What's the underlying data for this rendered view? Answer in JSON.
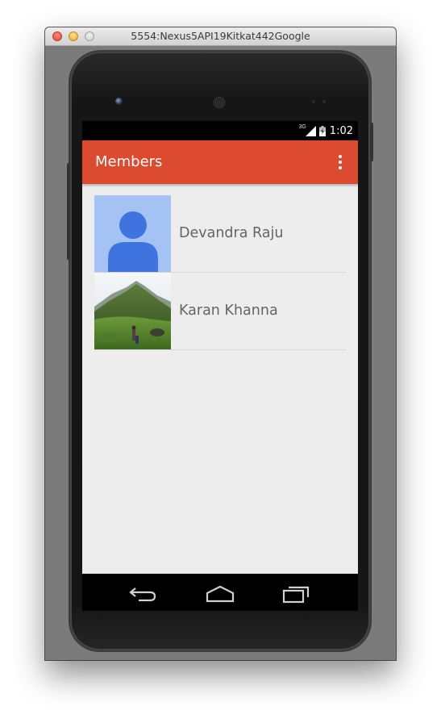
{
  "window": {
    "title": "5554:Nexus5API19Kitkat442Google"
  },
  "statusbar": {
    "network_label": "3G",
    "time": "1:02",
    "icons": [
      "signal-icon",
      "battery-charging-icon"
    ]
  },
  "toolbar": {
    "title": "Members",
    "overflow_icon": "more-vertical-icon",
    "background_color": "#dc4a2f"
  },
  "members": [
    {
      "name": "Devandra Raju",
      "photo": "default-avatar-icon"
    },
    {
      "name": "Karan Khanna",
      "photo": "landscape-photo"
    }
  ],
  "navbar": {
    "buttons": [
      "back-icon",
      "home-icon",
      "recents-icon"
    ]
  }
}
